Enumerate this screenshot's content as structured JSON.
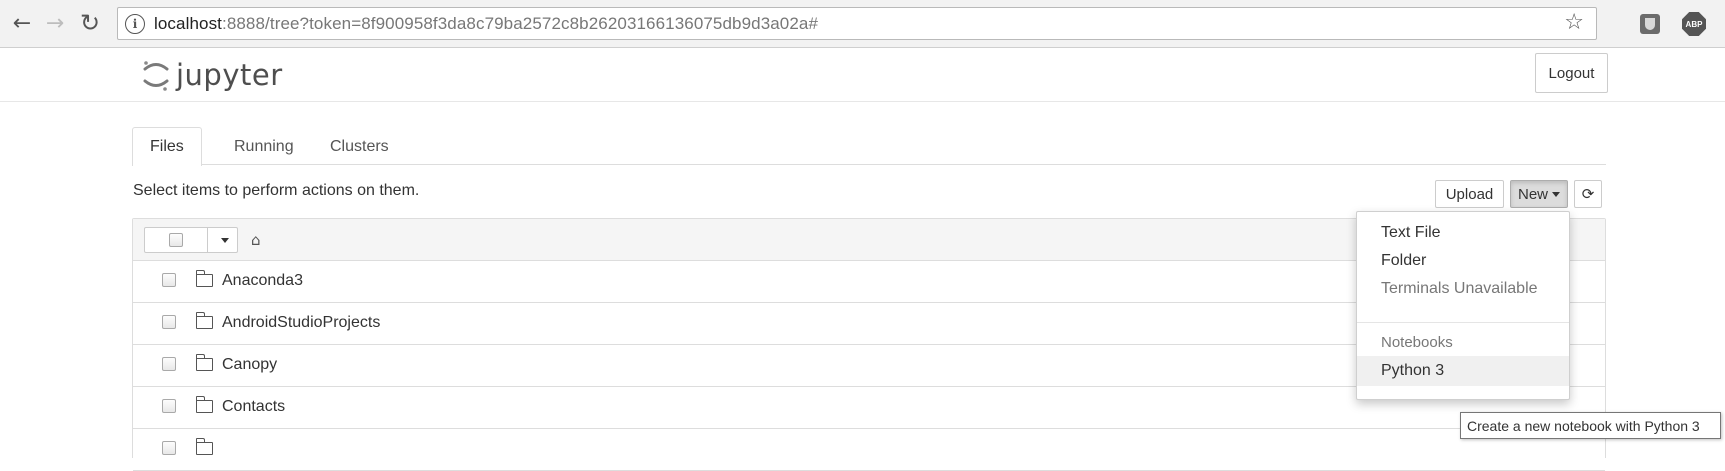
{
  "browser": {
    "url_host": "localhost",
    "url_rest": ":8888/tree?token=8f900958f3da8c79ba2572c8b26203166136075db9d3a02a#",
    "back_icon": "←",
    "forward_icon": "→",
    "reload_icon": "↻",
    "star_icon": "☆",
    "abp_label": "ABP"
  },
  "header": {
    "logo_text": "jupyter",
    "logout_label": "Logout"
  },
  "tabs": [
    {
      "label": "Files",
      "active": true
    },
    {
      "label": "Running",
      "active": false
    },
    {
      "label": "Clusters",
      "active": false
    }
  ],
  "toolbar": {
    "message": "Select items to perform actions on them.",
    "upload_label": "Upload",
    "new_label": "New",
    "refresh_icon": "⟳"
  },
  "file_list": {
    "home_icon": "⌂",
    "items": [
      {
        "name": "Anaconda3",
        "type": "folder"
      },
      {
        "name": "AndroidStudioProjects",
        "type": "folder"
      },
      {
        "name": "Canopy",
        "type": "folder"
      },
      {
        "name": "Contacts",
        "type": "folder"
      },
      {
        "name": "",
        "type": "folder"
      }
    ]
  },
  "new_menu": {
    "items": [
      {
        "label": "Text File"
      },
      {
        "label": "Folder"
      },
      {
        "label": "Terminals Unavailable"
      }
    ],
    "section_header": "Notebooks",
    "notebook_item": "Python 3"
  },
  "tooltip": {
    "text": "Create a new notebook with Python 3"
  },
  "colors": {
    "tab_border": "#dddddd",
    "list_header_bg": "#f5f5f5",
    "new_button_bg": "#dcdcdc",
    "logo_orange": "#f37726"
  }
}
